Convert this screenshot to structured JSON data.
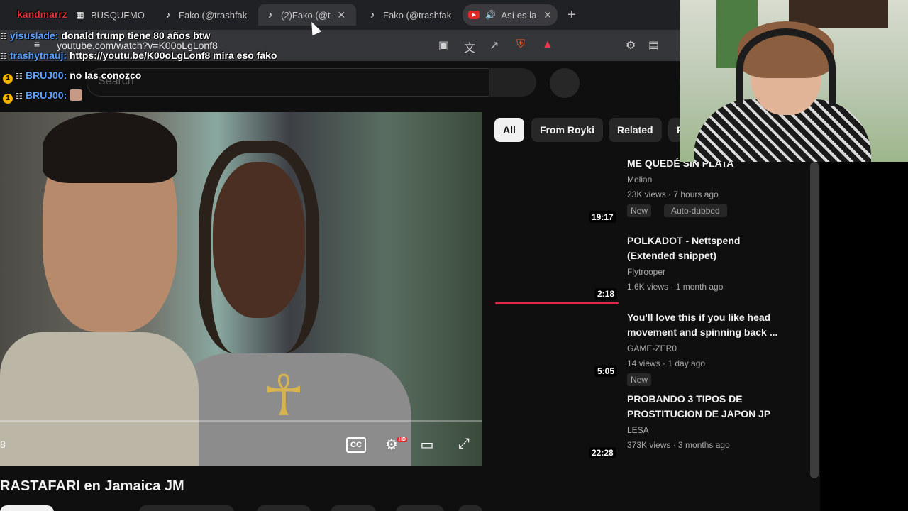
{
  "browser": {
    "tabs": [
      {
        "label": "BUSQUEMO",
        "icon": "user-icon"
      },
      {
        "label": "Fako (@trashfak",
        "icon": "tiktok-icon"
      },
      {
        "label": "(2)Fako (@t",
        "icon": "tiktok-icon",
        "active": true
      },
      {
        "label": "Fako (@trashfak",
        "icon": "tiktok-icon"
      },
      {
        "label": "Así es la",
        "icon": "youtube-icon",
        "audio": true
      }
    ],
    "url": "youtube.com/watch?v=K00oLgLonf8"
  },
  "search": {
    "placeholder": "Search"
  },
  "chat": [
    {
      "user": "kandmarrz",
      "message": "",
      "color": "#e0303a"
    },
    {
      "user": "yisuslade:",
      "message": "donald trump tiene 80 años btw",
      "color": "#5aa0ff"
    },
    {
      "user": "trashytnauj:",
      "message": "https://youtu.be/K00oLgLonf8 mira eso fako",
      "color": "#5aa0ff"
    },
    {
      "user": "BRUJ00:",
      "message": "no las conozco",
      "color": "#5aa0ff"
    },
    {
      "user": "BRUJ00:",
      "message": "",
      "color": "#5aa0ff"
    }
  ],
  "video": {
    "title": "RASTAFARI en Jamaica JM",
    "time": "8",
    "hd_badge": "HD",
    "cc_label": "CC"
  },
  "chips": [
    "All",
    "From Royki",
    "Related",
    "F"
  ],
  "recommendations": [
    {
      "title": "ME QUEDÉ SIN PLATA",
      "channel": "Melian",
      "meta": "23K views · 7 hours ago",
      "duration": "19:17",
      "badges": [
        "New",
        "Auto-dubbed"
      ]
    },
    {
      "title": "POLKADOT - Nettspend (Extended snippet)",
      "channel": "Flytrooper",
      "meta": "1.6K views · 1 month ago",
      "duration": "2:18",
      "badges": [],
      "progress": 1.0
    },
    {
      "title": "You'll love this if you like head movement and spinning back ...",
      "channel": "GAME-ZER0",
      "meta": "14 views · 1 day ago",
      "duration": "5:05",
      "badges": [
        "New"
      ]
    },
    {
      "title": "PROBANDO 3 TIPOS DE PROSTITUCION DE JAPON JP",
      "channel": "LESA",
      "meta": "373K views · 3 months ago",
      "duration": "22:28",
      "badges": []
    }
  ],
  "colors": {
    "accent": "#e0264f",
    "chat_name": "#5aa0ff",
    "background": "#0f0f0f"
  }
}
